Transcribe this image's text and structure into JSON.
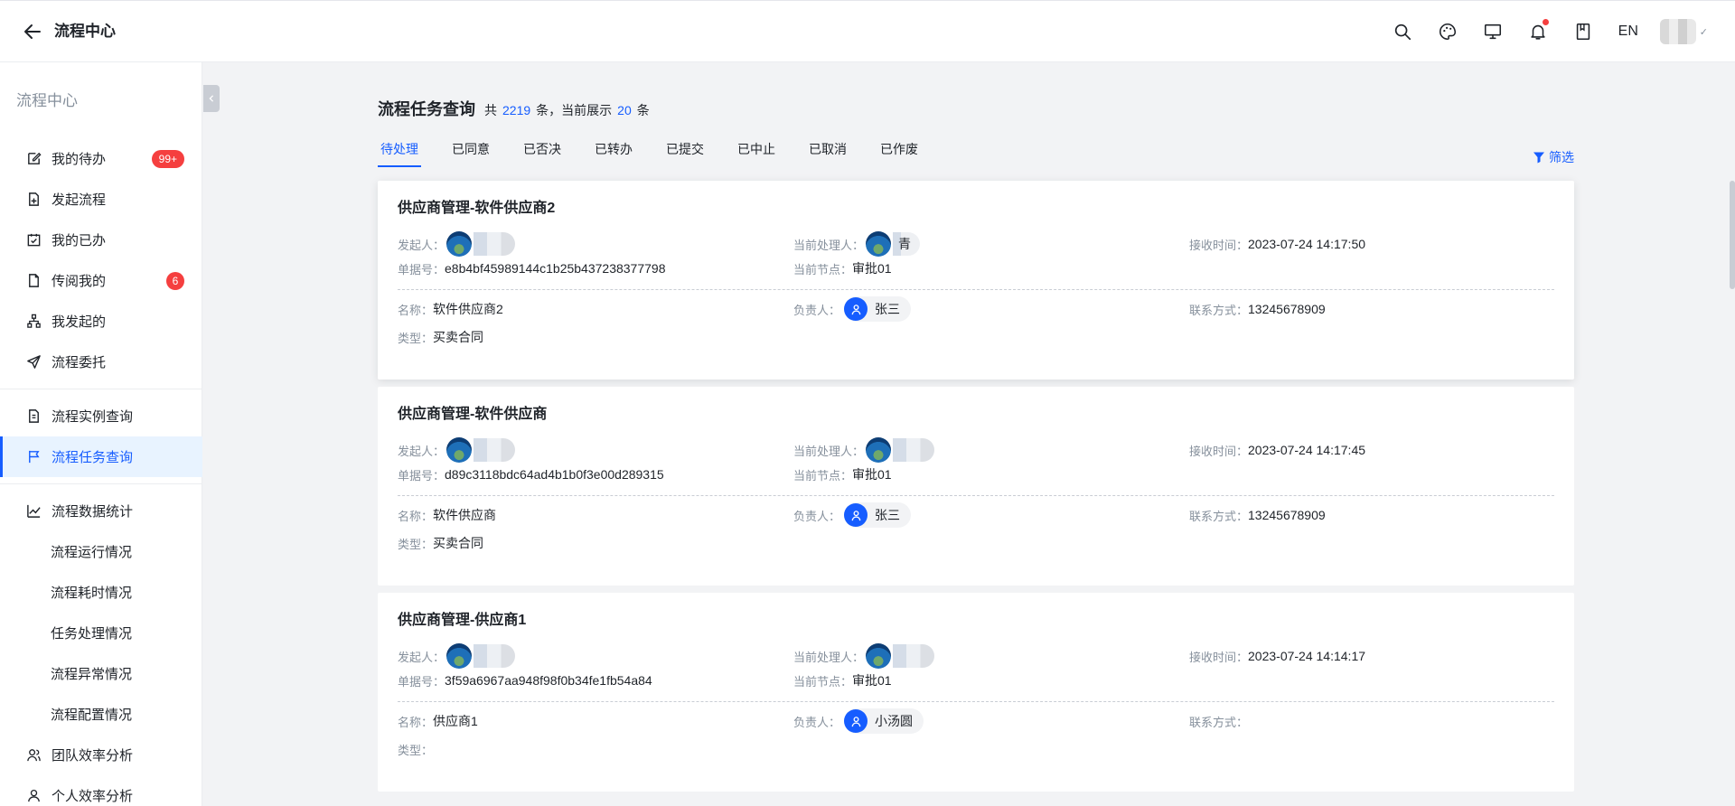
{
  "header": {
    "title": "流程中心",
    "lang": "EN",
    "icons": [
      "back-arrow-icon",
      "search-icon",
      "palette-icon",
      "monitor-icon",
      "bell-icon",
      "book-icon"
    ]
  },
  "sidebar": {
    "title": "流程中心",
    "groups": [
      [
        {
          "label": "我的待办",
          "icon": "edit-icon",
          "badge": "99+"
        },
        {
          "label": "发起流程",
          "icon": "file-add-icon"
        },
        {
          "label": "我的已办",
          "icon": "calendar-check-icon"
        },
        {
          "label": "传阅我的",
          "icon": "file-icon",
          "badge": "6"
        },
        {
          "label": "我发起的",
          "icon": "org-tree-icon"
        },
        {
          "label": "流程委托",
          "icon": "send-icon"
        }
      ],
      [
        {
          "label": "流程实例查询",
          "icon": "file-search-icon"
        },
        {
          "label": "流程任务查询",
          "icon": "flag-icon",
          "active": true
        }
      ],
      [
        {
          "label": "流程数据统计",
          "icon": "chart-line-icon"
        },
        {
          "label": "流程运行情况",
          "sub": true
        },
        {
          "label": "流程耗时情况",
          "sub": true
        },
        {
          "label": "任务处理情况",
          "sub": true
        },
        {
          "label": "流程异常情况",
          "sub": true
        },
        {
          "label": "流程配置情况",
          "sub": true
        },
        {
          "label": "团队效率分析",
          "icon": "team-icon"
        },
        {
          "label": "个人效率分析",
          "icon": "user-icon"
        }
      ]
    ]
  },
  "main": {
    "title": "流程任务查询",
    "stat_prefix": "共",
    "total": "2219",
    "stat_mid": "条，当前展示",
    "shown": "20",
    "stat_suffix": "条",
    "filter_label": "筛选",
    "tabs": [
      "待处理",
      "已同意",
      "已否决",
      "已转办",
      "已提交",
      "已中止",
      "已取消",
      "已作废"
    ],
    "active_tab": 0
  },
  "labels": {
    "initiator": "发起人：",
    "handler": "当前处理人：",
    "received": "接收时间：",
    "order_no": "单据号：",
    "node": "当前节点：",
    "name": "名称：",
    "owner": "负责人：",
    "contact": "联系方式：",
    "type": "类型："
  },
  "tasks": [
    {
      "title": "供应商管理-软件供应商2",
      "handler_text": "青",
      "received": "2023-07-24 14:17:50",
      "order_no": "e8b4bf45989144c1b25b437238377798",
      "node": "审批01",
      "name": "软件供应商2",
      "owner": "张三",
      "contact": "13245678909",
      "type": "买卖合同"
    },
    {
      "title": "供应商管理-软件供应商",
      "handler_text": "",
      "received": "2023-07-24 14:17:45",
      "order_no": "d89c3118bdc64ad4b1b0f3e00d289315",
      "node": "审批01",
      "name": "软件供应商",
      "owner": "张三",
      "contact": "13245678909",
      "type": "买卖合同"
    },
    {
      "title": "供应商管理-供应商1",
      "handler_text": "",
      "received": "2023-07-24 14:14:17",
      "order_no": "3f59a6967aa948f98f0b34fe1fb54a84",
      "node": "审批01",
      "name": "供应商1",
      "owner": "小汤圆",
      "contact": "",
      "type": ""
    }
  ]
}
